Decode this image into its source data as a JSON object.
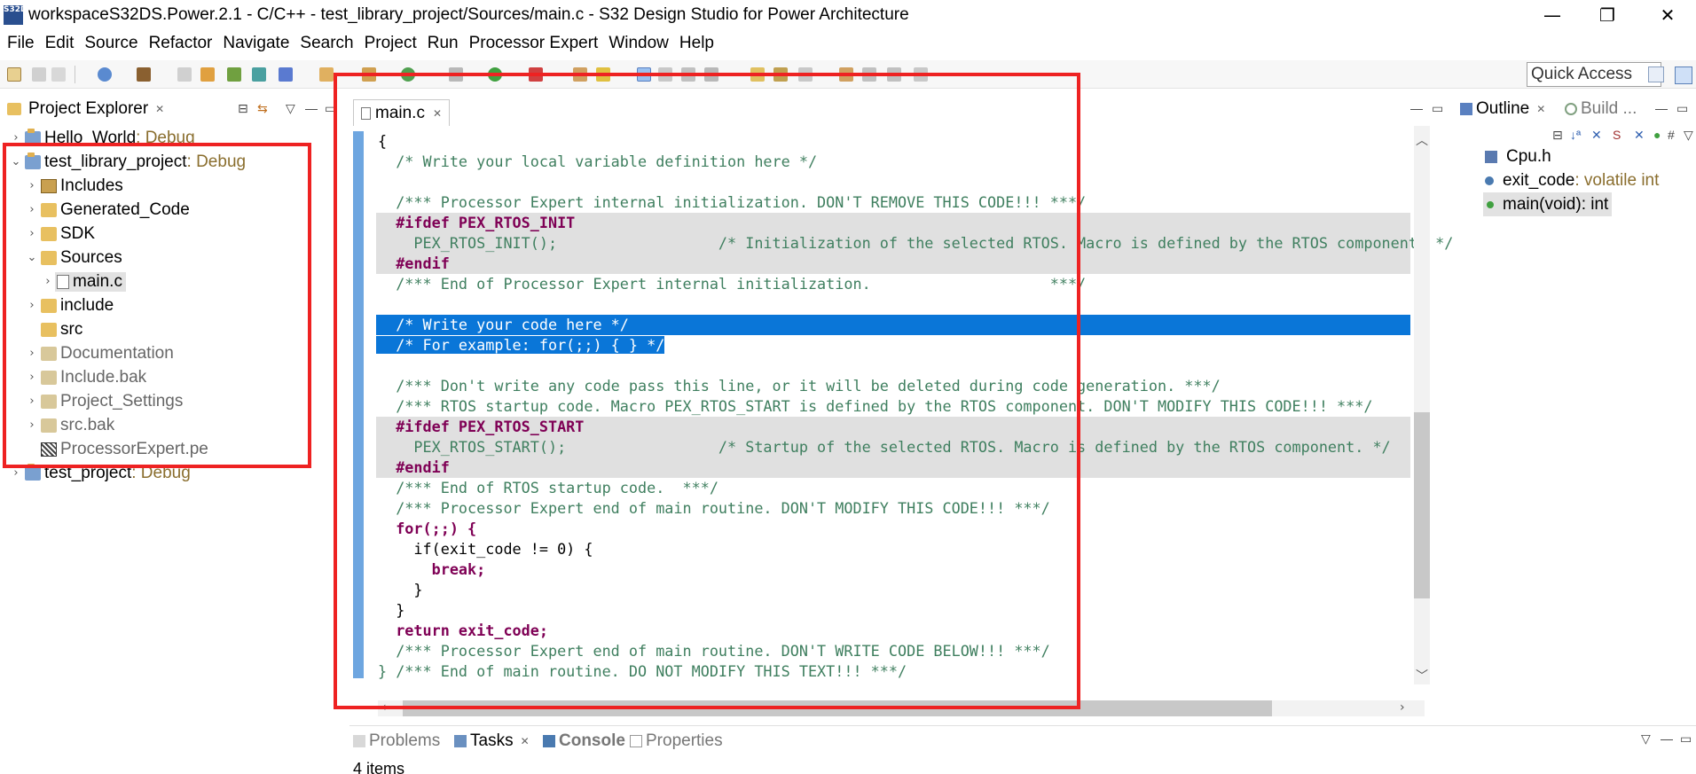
{
  "window": {
    "title": "workspaceS32DS.Power.2.1 - C/C++ - test_library_project/Sources/main.c - S32 Design Studio for Power Architecture",
    "icon_text": "S32DS",
    "minimize": "—",
    "maximize": "❐",
    "close": "✕"
  },
  "menu": [
    {
      "label": "File"
    },
    {
      "label": "Edit"
    },
    {
      "label": "Source"
    },
    {
      "label": "Refactor"
    },
    {
      "label": "Navigate"
    },
    {
      "label": "Search"
    },
    {
      "label": "Project"
    },
    {
      "label": "Run"
    },
    {
      "label": "Processor Expert"
    },
    {
      "label": "Window"
    },
    {
      "label": "Help"
    }
  ],
  "toolbar": {
    "quick_access": "Quick Access"
  },
  "project_explorer": {
    "title": "Project Explorer",
    "items": [
      {
        "label": "Hello_World",
        "decoration": ": Debug",
        "icon": "project-icon"
      },
      {
        "label": "test_library_project",
        "decoration": ": Debug",
        "icon": "project-icon"
      },
      {
        "label": "Includes",
        "icon": "includes-icon"
      },
      {
        "label": "Generated_Code",
        "icon": "folder-icon"
      },
      {
        "label": "SDK",
        "icon": "folder-icon"
      },
      {
        "label": "Sources",
        "icon": "folder-icon"
      },
      {
        "label": "main.c",
        "icon": "c-file-icon"
      },
      {
        "label": "include",
        "icon": "folder-icon"
      },
      {
        "label": "src",
        "icon": "folder-icon"
      },
      {
        "label": "Documentation",
        "icon": "excluded-folder-icon"
      },
      {
        "label": "Include.bak",
        "icon": "excluded-folder-icon"
      },
      {
        "label": "Project_Settings",
        "icon": "excluded-folder-icon"
      },
      {
        "label": "src.bak",
        "icon": "excluded-folder-icon"
      },
      {
        "label": "ProcessorExpert.pe",
        "icon": "pe-file-icon"
      },
      {
        "label": "test_project",
        "decoration": ": Debug",
        "icon": "project-icon"
      }
    ]
  },
  "editor": {
    "tab_label": "main.c",
    "lines": [
      "{",
      "  /* Write your local variable definition here */",
      "",
      "  /*** Processor Expert internal initialization. DON'T REMOVE THIS CODE!!! ***/",
      "  #ifdef PEX_RTOS_INIT",
      "    PEX_RTOS_INIT();                  /* Initialization of the selected RTOS. Macro is defined by the RTOS component. */",
      "  #endif",
      "  /*** End of Processor Expert internal initialization.                    ***/",
      "",
      "  /* Write your code here */",
      "  /* For example: for(;;) { } */",
      "",
      "  /*** Don't write any code pass this line, or it will be deleted during code generation. ***/",
      "  /*** RTOS startup code. Macro PEX_RTOS_START is defined by the RTOS component. DON'T MODIFY THIS CODE!!! ***/",
      "  #ifdef PEX_RTOS_START",
      "    PEX_RTOS_START();                 /* Startup of the selected RTOS. Macro is defined by the RTOS component. */",
      "  #endif",
      "  /*** End of RTOS startup code.  ***/",
      "  /*** Processor Expert end of main routine. DON'T MODIFY THIS CODE!!! ***/",
      "  for(;;) {",
      "    if(exit_code != 0) {",
      "      break;",
      "    }",
      "  }",
      "  return exit_code;",
      "  /*** Processor Expert end of main routine. DON'T WRITE CODE BELOW!!! ***/",
      "} /*** End of main routine. DO NOT MODIFY THIS TEXT!!! ***/"
    ]
  },
  "outline": {
    "title": "Outline",
    "build_tab": "Build ...",
    "items": [
      {
        "name": "Cpu.h",
        "type": ""
      },
      {
        "name": "exit_code",
        "type": " : volatile int"
      },
      {
        "name": "main(void)",
        "type": " : int"
      }
    ]
  },
  "bottom": {
    "tabs": [
      "Problems",
      "Tasks",
      "Console",
      "Properties"
    ],
    "items_count": "4 items"
  },
  "colors": {
    "selection": "#0a76d8",
    "annotation": "#ee2222",
    "comment": "#3f7f5f",
    "keyword": "#7f0055",
    "decoration": "#8a6e2e"
  }
}
